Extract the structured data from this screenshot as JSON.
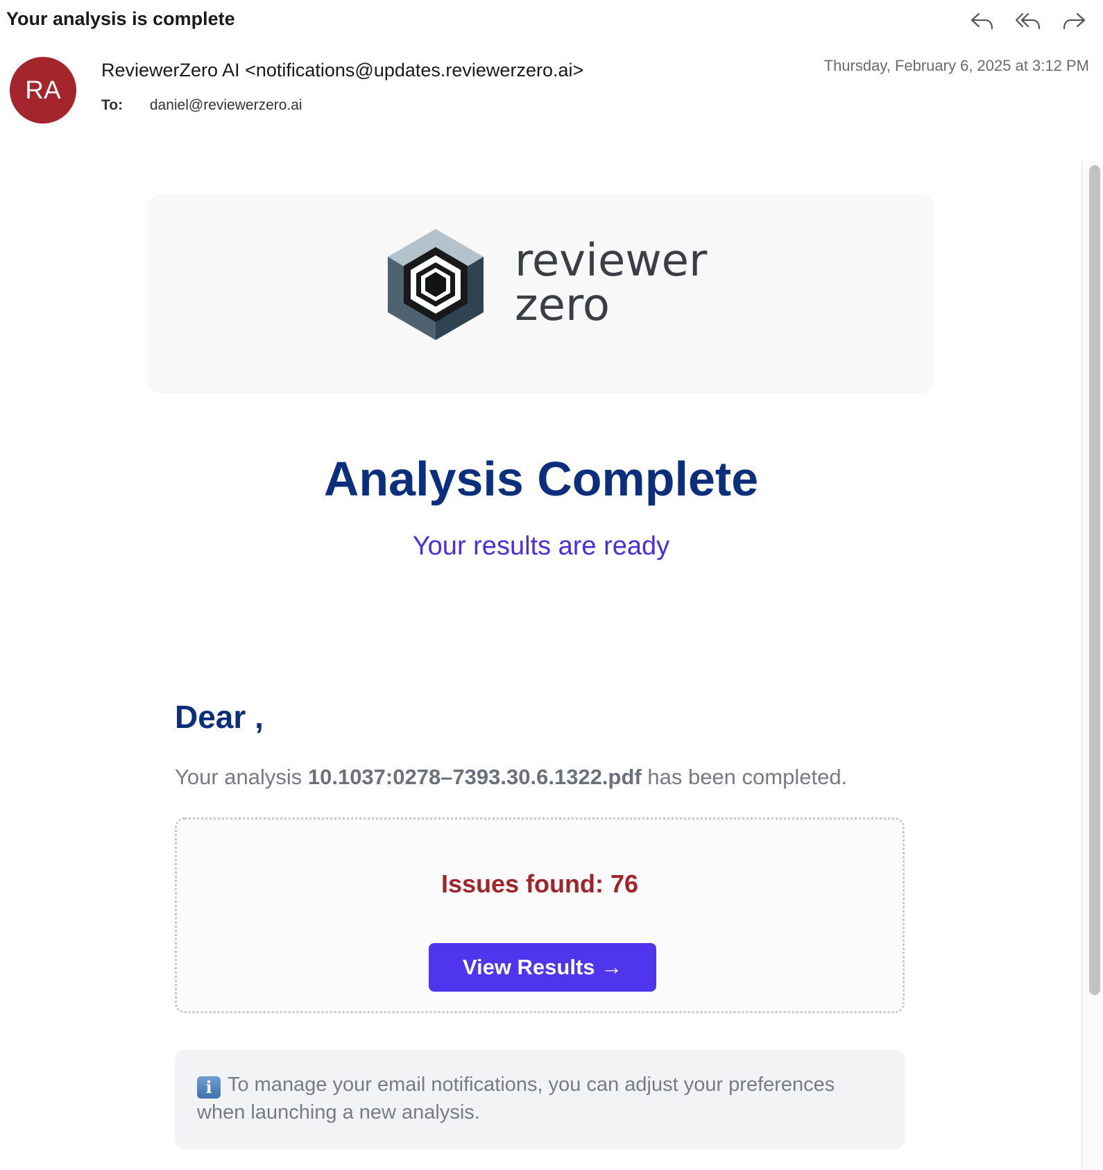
{
  "email": {
    "subject": "Your analysis is complete",
    "sender_initials": "RA",
    "sender": "ReviewerZero AI <notifications@updates.reviewerzero.ai>",
    "to_label": "To:",
    "to_address": "daniel@reviewerzero.ai",
    "date": "Thursday, February 6, 2025 at 3:12 PM",
    "actions": [
      {
        "name": "reply",
        "icon": "reply-icon"
      },
      {
        "name": "reply-all",
        "icon": "reply-all-icon"
      },
      {
        "name": "forward",
        "icon": "forward-icon"
      }
    ]
  },
  "body": {
    "logo_line1": "reviewer",
    "logo_line2": "zero",
    "title": "Analysis Complete",
    "subtitle": "Your results are ready",
    "greeting": "Dear ,",
    "intro_prefix": "Your analysis ",
    "file_name": "10.1037:0278–7393.30.6.1322.pdf",
    "intro_suffix": " has been completed.",
    "issues": "Issues found: 76",
    "button_label": "View Results →",
    "info_icon": "i",
    "notice": "To manage your email notifications, you can adjust your preferences when launching a new analysis."
  },
  "colors": {
    "avatar": "#a4262c",
    "title": "#0b2f7d",
    "subtitle": "#4a2ee6",
    "issues": "#a0252b",
    "button": "#4f35ec"
  }
}
